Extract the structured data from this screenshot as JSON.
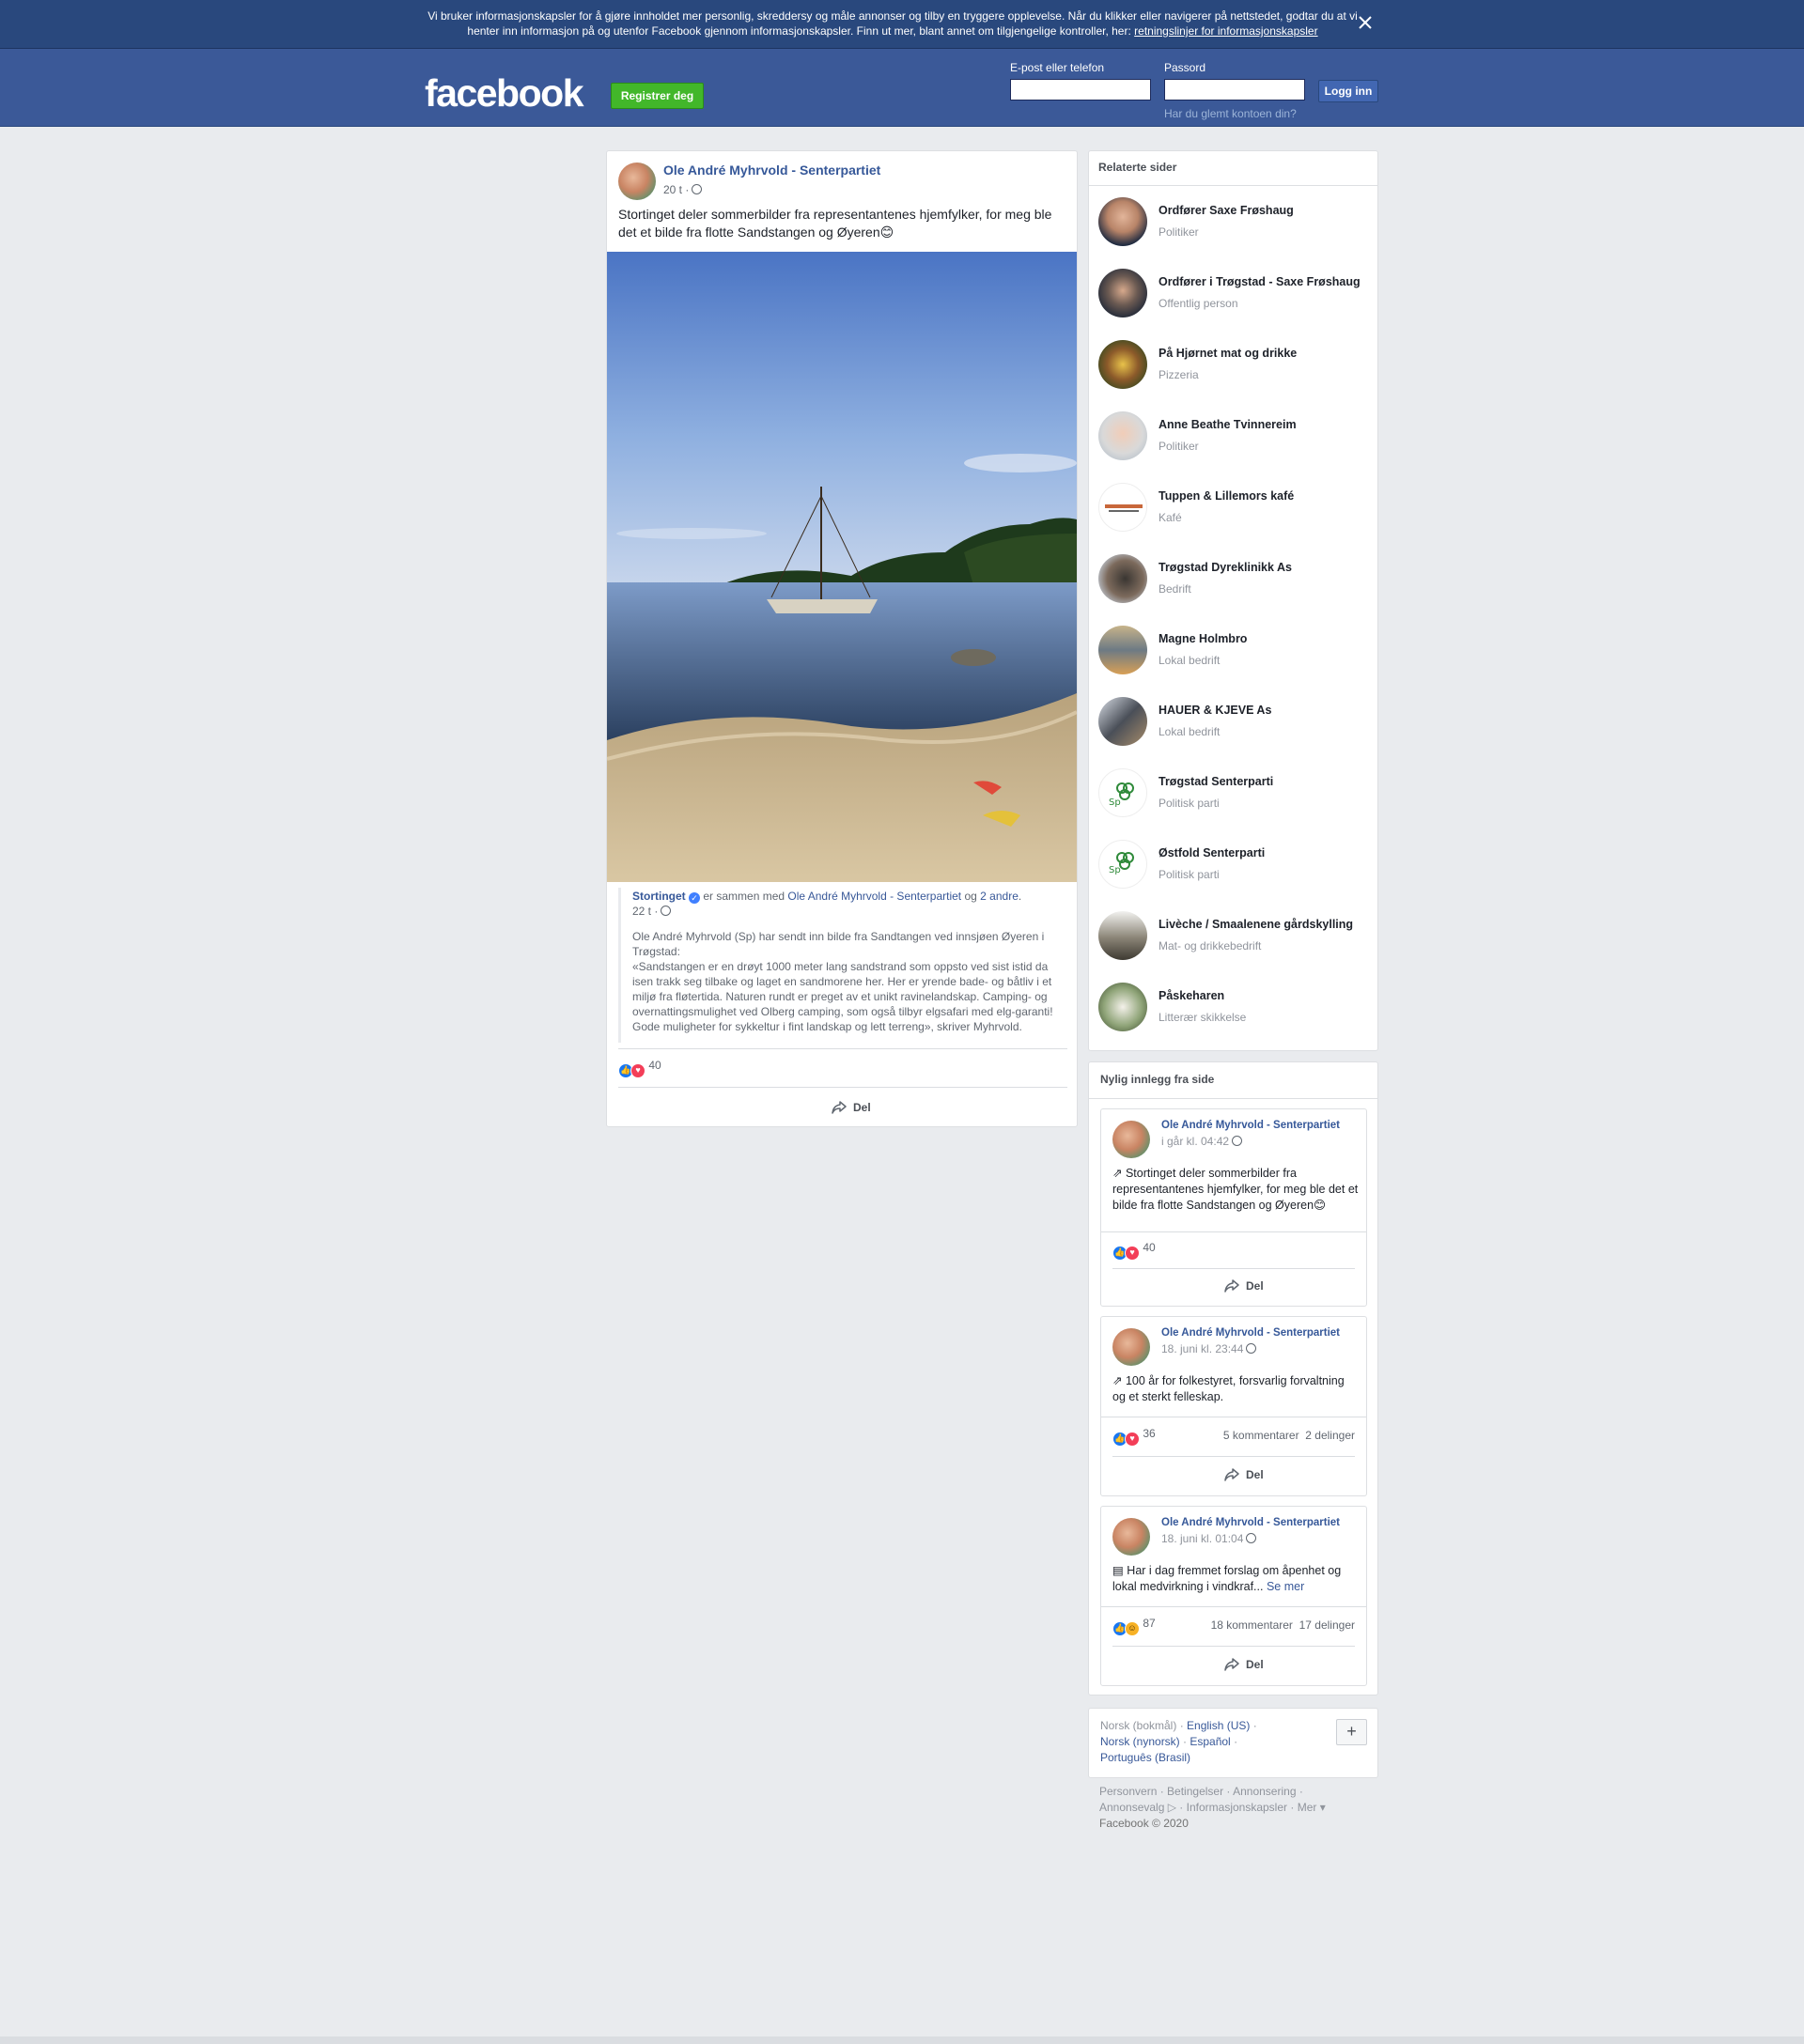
{
  "cookie_banner": {
    "text": "Vi bruker informasjonskapsler for å gjøre innholdet mer personlig, skreddersy og måle annonser og tilby en tryggere opplevelse. Når du klikker eller navigerer på nettstedet, godtar du at vi henter inn informasjon på og utenfor Facebook gjennom informasjonskapsler. Finn ut mer, blant annet om tilgjengelige kontroller, her: ",
    "link": "retningslinjer for informasjonskapsler",
    "close_icon": "close-icon"
  },
  "header": {
    "logo": "facebook",
    "register_button": "Registrer deg",
    "email_label": "E-post eller telefon",
    "password_label": "Passord",
    "login_button": "Logg inn",
    "forgot_link": "Har du glemt kontoen din?"
  },
  "post": {
    "author": "Ole André Myhrvold - Senterpartiet",
    "time": "20 t ·",
    "text": "Stortinget deler sommerbilder fra representantenes hjemfylker, for meg ble det et bilde fra flotte Sandstangen og Øyeren😊",
    "shared": {
      "page": "Stortinget",
      "with_text": " er sammen med ",
      "with_person": "Ole André Myhrvold - Senterpartiet",
      "and_text": " og ",
      "others": "2 andre",
      "time": "22 t ·",
      "body_line1": "Ole André Myhrvold (Sp) har sendt inn bilde fra Sandtangen ved innsjøen Øyeren i Trøgstad:",
      "body_line2": "«Sandstangen er en drøyt 1000 meter lang sandstrand som oppsto ved sist istid da isen trakk seg tilbake og laget en sandmorene her. Her er yrende bade- og båtliv i et miljø fra fløtertida. Naturen rundt er preget av et unikt ravinelandskap. Camping- og overnattingsmulighet ved Olberg camping, som også tilbyr elgsafari med elg-garanti! Gode muligheter for sykkeltur i fint landskap og lett terreng», skriver Myhrvold."
    },
    "reaction_count": "40",
    "share_label": "Del"
  },
  "related": {
    "title": "Relaterte sider",
    "items": [
      {
        "name": "Ordfører Saxe Frøshaug",
        "category": "Politiker"
      },
      {
        "name": "Ordfører i Trøgstad - Saxe Frøshaug",
        "category": "Offentlig person"
      },
      {
        "name": "På Hjørnet mat og drikke",
        "category": "Pizzeria"
      },
      {
        "name": "Anne Beathe Tvinnereim",
        "category": "Politiker"
      },
      {
        "name": "Tuppen & Lillemors kafé",
        "category": "Kafé"
      },
      {
        "name": "Trøgstad Dyreklinikk As",
        "category": "Bedrift"
      },
      {
        "name": "Magne Holmbro",
        "category": "Lokal bedrift"
      },
      {
        "name": "HAUER & KJEVE As",
        "category": "Lokal bedrift"
      },
      {
        "name": "Trøgstad Senterparti",
        "category": "Politisk parti"
      },
      {
        "name": "Østfold Senterparti",
        "category": "Politisk parti"
      },
      {
        "name": "Livèche / Smaalenene gårdskylling",
        "category": "Mat- og drikkebedrift"
      },
      {
        "name": "Påskeharen",
        "category": "Litterær skikkelse"
      }
    ]
  },
  "recent": {
    "title": "Nylig innlegg fra side",
    "posts": [
      {
        "author": "Ole André Myhrvold - Senterpartiet",
        "time": "i går kl. 04:42",
        "text": "Stortinget deler sommerbilder fra representantenes hjemfylker, for meg ble det et bilde fra flotte Sandstangen og Øyeren😊",
        "reactions": "40",
        "comments": "",
        "shares": "",
        "share_label": "Del"
      },
      {
        "author": "Ole André Myhrvold - Senterpartiet",
        "time": "18. juni kl. 23:44",
        "text": "100 år for folkestyret, forsvarlig forvaltning og et sterkt felleskap.",
        "reactions": "36",
        "comments": "5 kommentarer",
        "shares": "2 delinger",
        "share_label": "Del"
      },
      {
        "author": "Ole André Myhrvold - Senterpartiet",
        "time": "18. juni kl. 01:04",
        "text": "Har i dag fremmet forslag om åpenhet og lokal medvirkning i vindkraf...",
        "see_more": "Se mer",
        "reactions": "87",
        "comments": "18 kommentarer",
        "shares": "17 delinger",
        "share_label": "Del"
      }
    ]
  },
  "languages": {
    "current": "Norsk (bokmål)",
    "options": [
      "English (US)",
      "Norsk (nynorsk)",
      "Español",
      "Português (Brasil)"
    ],
    "plus": "+"
  },
  "footer": {
    "links": [
      "Personvern",
      "Betingelser",
      "Annonsering",
      "Annonsevalg",
      "Informasjonskapsler",
      "Mer"
    ],
    "copyright": "Facebook © 2020"
  }
}
